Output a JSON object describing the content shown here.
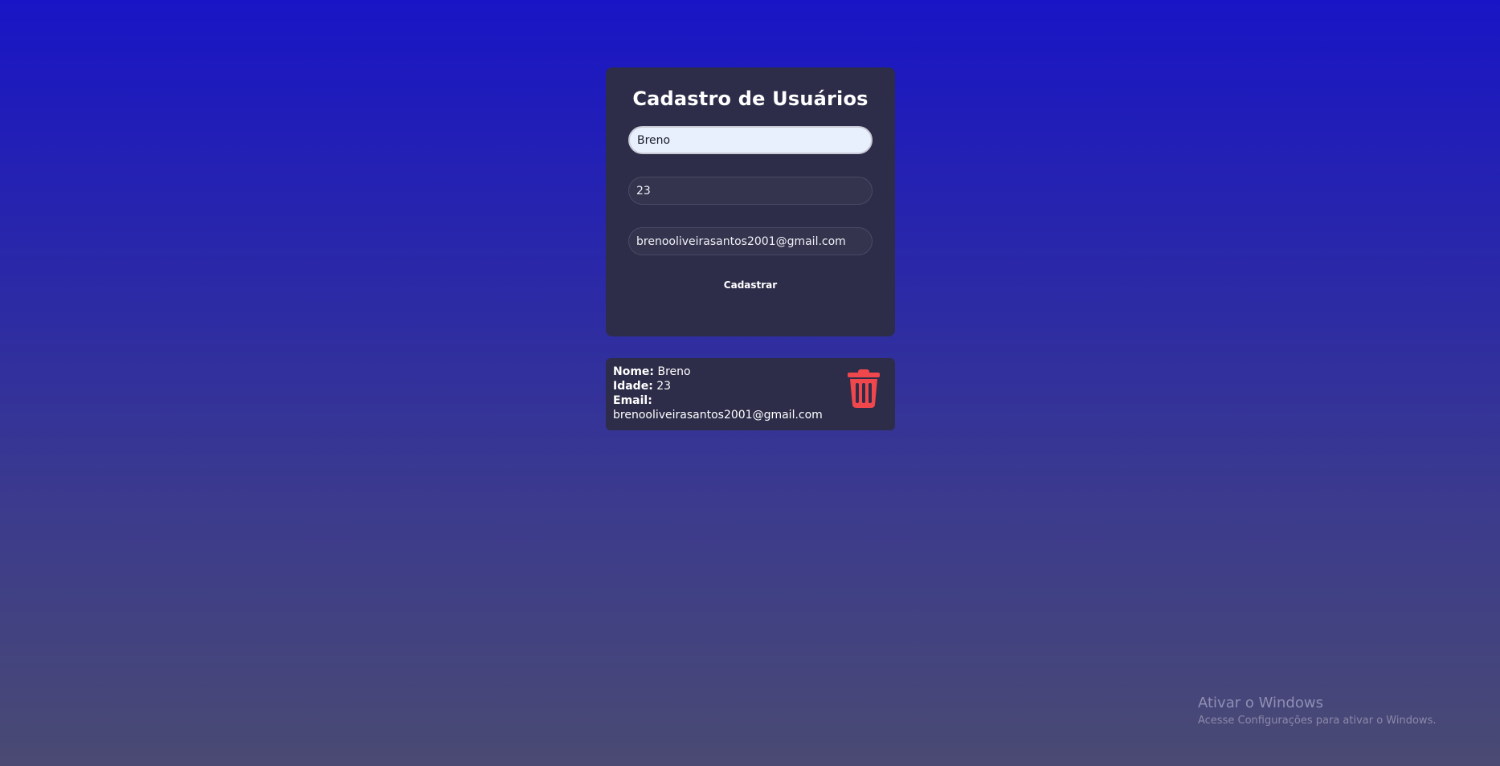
{
  "form": {
    "title": "Cadastro de Usuários",
    "name_value": "Breno",
    "age_value": "23",
    "email_value": "brenooliveirasantos2001@gmail.com",
    "submit_label": "Cadastrar"
  },
  "user_card": {
    "name_label": "Nome:",
    "name_value": "Breno",
    "age_label": "Idade:",
    "age_value": "23",
    "email_label": "Email:",
    "email_value": "brenooliveirasantos2001@gmail.com",
    "delete_icon": "trash-icon",
    "delete_color": "#f0474c"
  },
  "watermark": {
    "title": "Ativar o Windows",
    "subtitle": "Acesse Configurações para ativar o Windows."
  },
  "colors": {
    "background_top": "#1915c6",
    "background_bottom": "#4a4a73",
    "card": "#2d2d4a"
  }
}
